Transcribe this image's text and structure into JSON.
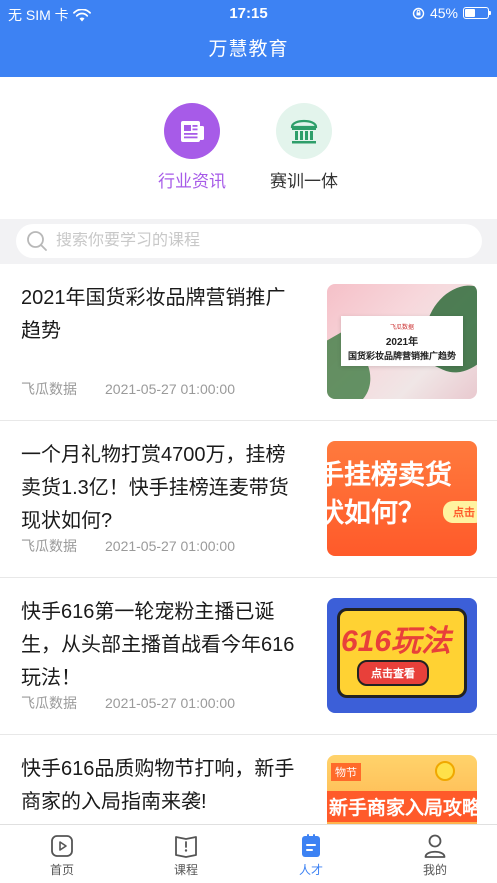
{
  "status_bar": {
    "carrier": "无 SIM 卡",
    "time": "17:15",
    "battery": "45%",
    "battery_level": 0.45
  },
  "header": {
    "title": "万慧教育"
  },
  "categories": [
    {
      "label": "行业资讯",
      "icon": "newspaper-icon",
      "color": "#a75be8"
    },
    {
      "label": "赛训一体",
      "icon": "building-icon",
      "color": "#2e9e6a"
    }
  ],
  "search": {
    "placeholder": "搜索你要学习的课程"
  },
  "articles": [
    {
      "title": "2021年国货彩妆品牌营销推广趋势",
      "source": "飞瓜数据",
      "date": "2021-05-27 01:00:00",
      "thumb": {
        "logo": "飞瓜数据",
        "line1": "2021年",
        "line2": "国货彩妆品牌营销推广趋势"
      }
    },
    {
      "title": "一个月礼物打赏4700万，挂榜卖货1.3亿！快手挂榜连麦带货现状如何?",
      "source": "飞瓜数据",
      "date": "2021-05-27 01:00:00",
      "thumb": {
        "line1": "手挂榜卖货",
        "line2": "状如何？",
        "tag": "点击"
      }
    },
    {
      "title": "快手616第一轮宠粉主播已诞生，从头部主播首战看今年616玩法！",
      "source": "飞瓜数据",
      "date": "2021-05-27 01:00:00",
      "thumb": {
        "line1": "616玩法",
        "button": "点击查看"
      }
    },
    {
      "title": "快手616品质购物节打响，新手商家的入局指南来袭!",
      "source": "",
      "date": "",
      "thumb": {
        "badge": "物节",
        "line1": "新手商家入局攻略"
      }
    }
  ],
  "tabs": [
    {
      "label": "首页",
      "icon": "play-square-icon",
      "active": false
    },
    {
      "label": "课程",
      "icon": "book-icon",
      "active": false
    },
    {
      "label": "人才",
      "icon": "clipboard-icon",
      "active": true
    },
    {
      "label": "我的",
      "icon": "person-icon",
      "active": false
    }
  ],
  "colors": {
    "primary": "#3d82f3",
    "purple": "#a75be8",
    "green": "#2e9e6a"
  }
}
